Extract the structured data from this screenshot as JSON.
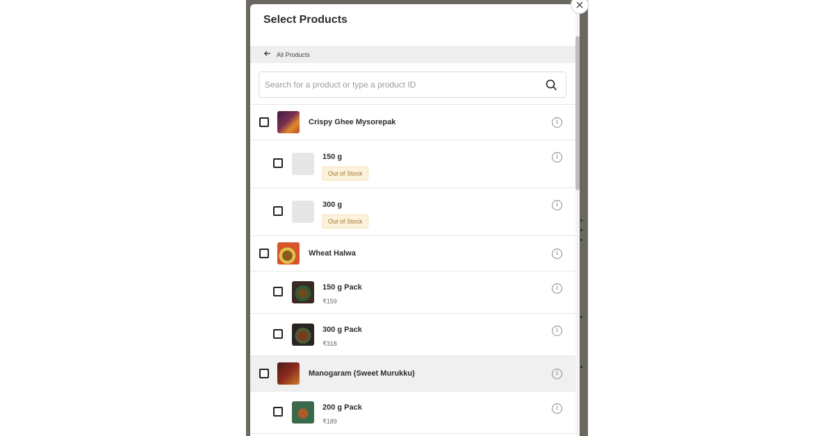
{
  "modal": {
    "title": "Select Products",
    "close_icon": "close-icon"
  },
  "breadcrumb": {
    "back_icon": "arrow-left-icon",
    "label": "All Products"
  },
  "search": {
    "placeholder": "Search for a product or type a product ID",
    "value": "",
    "icon": "search-icon"
  },
  "products": [
    {
      "name": "Crispy Ghee Mysorepak",
      "thumb_color": "#6a2a3a",
      "variants": [
        {
          "name": "150 g",
          "badge": "Out of Stock"
        },
        {
          "name": "300 g",
          "badge": "Out of Stock"
        }
      ]
    },
    {
      "name": "Wheat Halwa",
      "thumb_color": "#d8542a",
      "variants": [
        {
          "name": "150 g Pack",
          "price": "₹159"
        },
        {
          "name": "300 g Pack",
          "price": "₹318"
        }
      ]
    },
    {
      "name": "Manogaram (Sweet Murukku)",
      "thumb_color": "#7a2a1e",
      "variants": [
        {
          "name": "200 g Pack",
          "price": "₹189"
        }
      ]
    }
  ],
  "colors": {
    "backdrop": "#6b6761",
    "out_of_stock_badge_bg": "#fdf2dc",
    "out_of_stock_badge_text": "#a0752a"
  }
}
